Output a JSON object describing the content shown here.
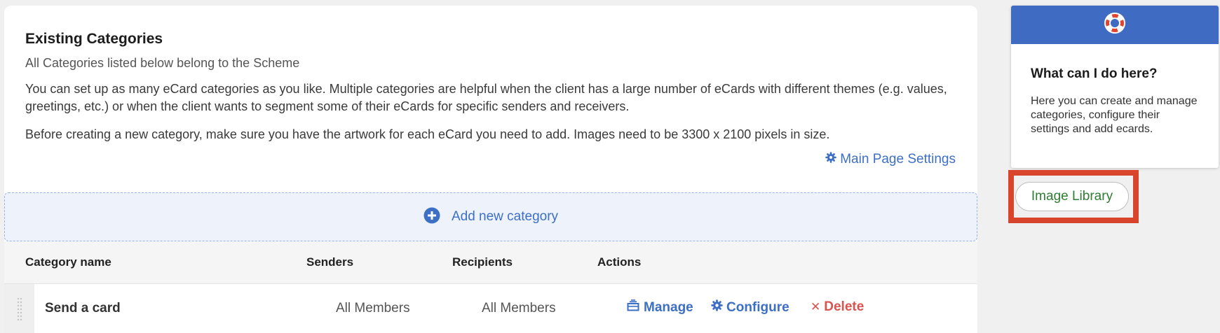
{
  "intro": {
    "title": "Existing Categories",
    "subtitle": "All Categories listed below belong to the Scheme",
    "paragraph1": "You can set up as many eCard categories as you like. Multiple categories are helpful when the client has a large number of eCards with different themes (e.g. values, greetings, etc.) or when the client wants to segment some of their eCards for specific senders and receivers.",
    "paragraph2": "Before creating a new category, make sure you have the artwork for each eCard you need to add. Images need to be 3300 x 2100 pixels in size.",
    "settings_link": "Main Page Settings"
  },
  "add_category": {
    "label": "Add new category"
  },
  "table": {
    "columns": [
      "Category name",
      "Senders",
      "Recipients",
      "Actions"
    ],
    "rows": [
      {
        "name": "Send a card",
        "senders": "All Members",
        "recipients": "All Members",
        "actions": {
          "manage": "Manage",
          "configure": "Configure",
          "delete": "Delete"
        }
      }
    ]
  },
  "help": {
    "title": "What can I do here?",
    "text": "Here you can create and manage categories, configure their settings and add ecards."
  },
  "image_library": {
    "label": "Image Library"
  },
  "colors": {
    "link_blue": "#3d6fc4",
    "header_blue": "#3f6bc3",
    "delete_red": "#d9534f",
    "highlight_red": "#d8442c",
    "library_green": "#2e7d32"
  },
  "icons": {
    "settings": "gear-icon",
    "add": "plus-circle-icon",
    "manage": "cards-icon",
    "configure": "gear-icon",
    "delete": "close-icon",
    "help": "lifebuoy-icon",
    "drag": "drag-handle-icon"
  }
}
